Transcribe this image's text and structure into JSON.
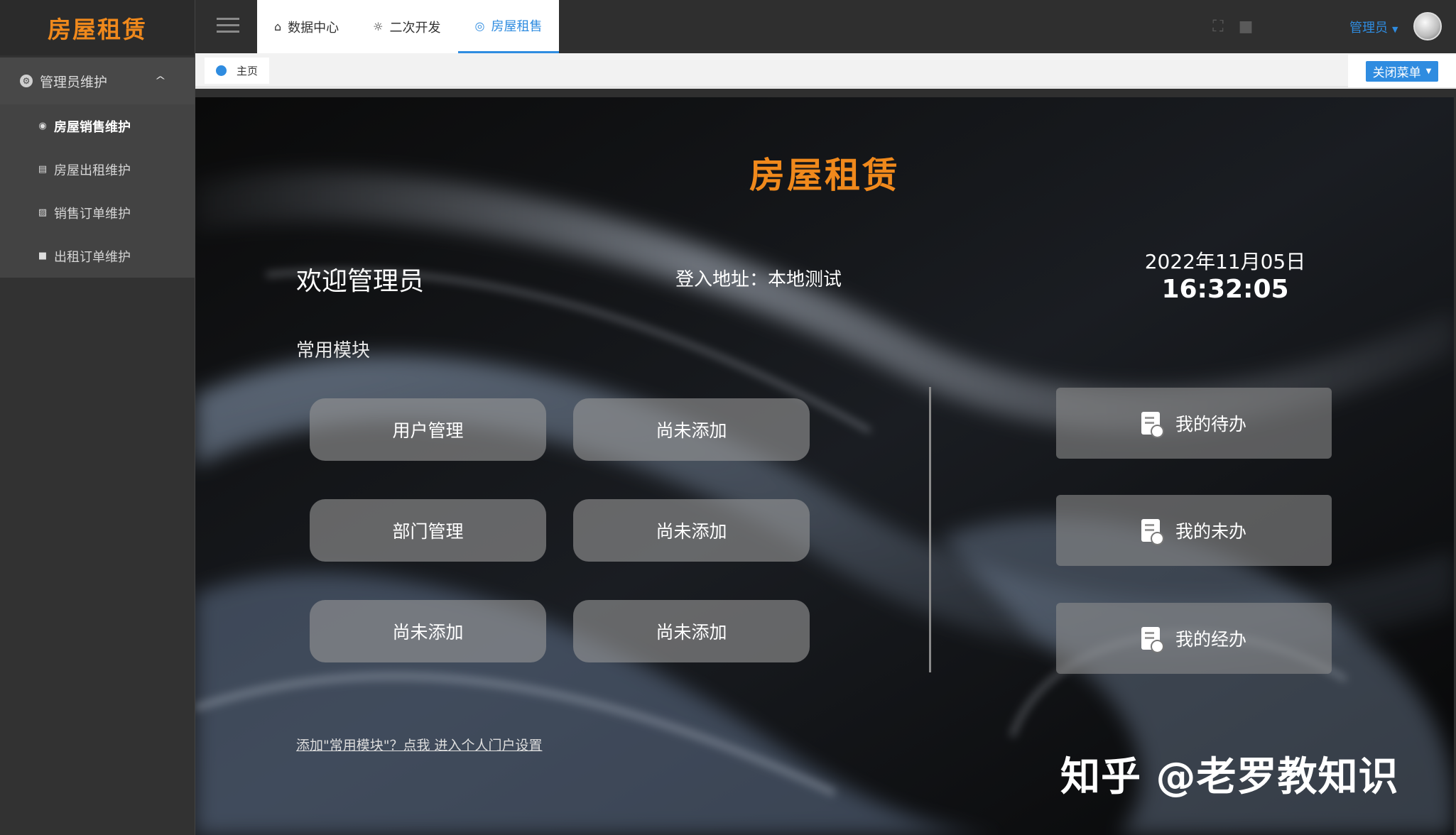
{
  "app": {
    "logo": "房屋租赁"
  },
  "sidebar": {
    "group_label": "管理员维护",
    "items": [
      {
        "label": "房屋销售维护"
      },
      {
        "label": "房屋出租维护"
      },
      {
        "label": "销售订单维护"
      },
      {
        "label": "出租订单维护"
      }
    ]
  },
  "topbar": {
    "tabs": [
      {
        "label": "数据中心",
        "icon": "home-icon"
      },
      {
        "label": "二次开发",
        "icon": "bulb-icon"
      },
      {
        "label": "房屋租售",
        "icon": "globe-icon"
      }
    ],
    "user": "管理员"
  },
  "breadcrumb": {
    "label": "主页"
  },
  "close_menu": "关闭菜单",
  "main": {
    "title": "房屋租赁",
    "welcome": "欢迎管理员",
    "login_address": "登入地址：本地测试",
    "date": "2022年11月05日",
    "time": "16:32:05",
    "section_title": "常用模块",
    "modules": [
      "用户管理",
      "尚未添加",
      "部门管理",
      "尚未添加",
      "尚未添加",
      "尚未添加"
    ],
    "tasks": [
      "我的待办",
      "我的未办",
      "我的经办"
    ],
    "add_link": "添加\"常用模块\"？点我 进入个人门户设置",
    "watermark": "知乎 @老罗教知识"
  },
  "colors": {
    "accent": "#2f8ce0",
    "logo": "#f0891c"
  }
}
